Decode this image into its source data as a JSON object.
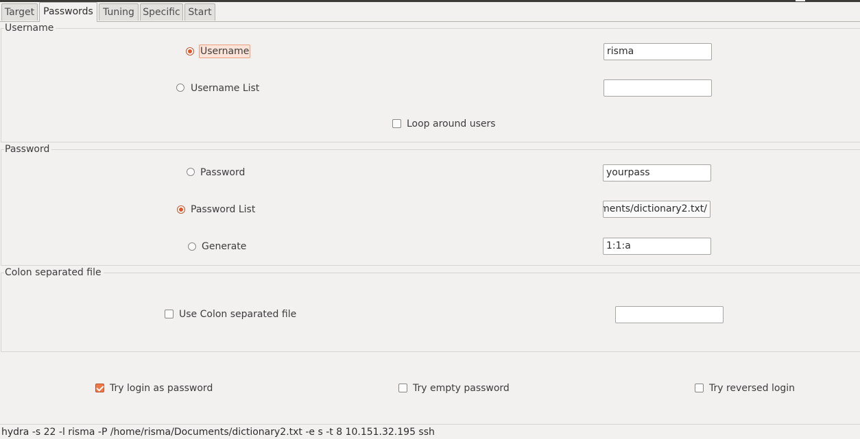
{
  "tabs": [
    {
      "label": "Target"
    },
    {
      "label": "Passwords",
      "active": true
    },
    {
      "label": "Tuning"
    },
    {
      "label": "Specific"
    },
    {
      "label": "Start"
    }
  ],
  "username_group": {
    "title": "Username",
    "username_radio_label": "Username",
    "username_selected": true,
    "username_value": "risma",
    "username_list_label": "Username List",
    "username_list_value": "",
    "loop_users_label": "Loop around users",
    "loop_users_checked": false
  },
  "password_group": {
    "title": "Password",
    "password_label": "Password",
    "password_value": "yourpass",
    "password_list_label": "Password List",
    "password_list_selected": true,
    "password_list_value": "/home/risma/Documents/dictionary2.txt",
    "generate_label": "Generate",
    "generate_value": "1:1:a"
  },
  "colon_group": {
    "title": "Colon separated file",
    "use_colon_label": "Use Colon separated file",
    "use_colon_checked": false,
    "colon_file_value": ""
  },
  "options": {
    "try_login_label": "Try login as password",
    "try_login_checked": true,
    "try_empty_label": "Try empty password",
    "try_empty_checked": false,
    "try_reversed_label": "Try reversed login",
    "try_reversed_checked": false
  },
  "status": {
    "command": "hydra -s 22 -l risma -P /home/risma/Documents/dictionary2.txt -e s -t 8 10.151.32.195 ssh"
  },
  "colors": {
    "accent": "#f07746",
    "window_bg": "#f2f1f0",
    "frame_border": "#d7d5d2"
  }
}
